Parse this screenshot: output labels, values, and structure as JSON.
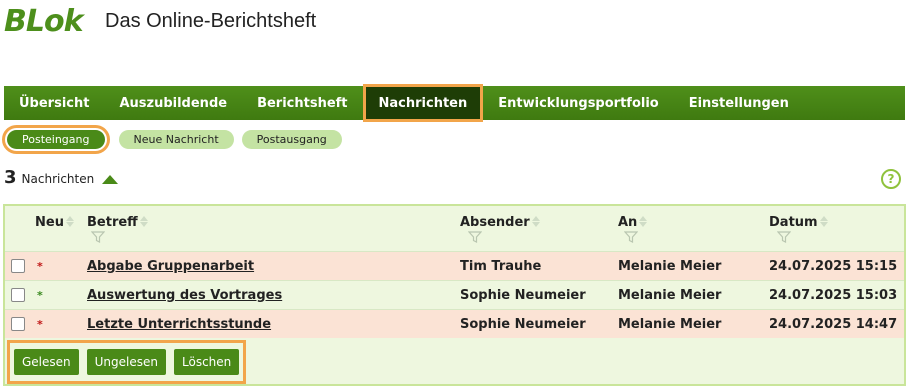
{
  "header": {
    "logo_text": "BLok",
    "title": "Das Online-Berichtsheft"
  },
  "nav": {
    "items": [
      {
        "label": "Übersicht"
      },
      {
        "label": "Auszubildende"
      },
      {
        "label": "Berichtsheft"
      },
      {
        "label": "Nachrichten",
        "active": true
      },
      {
        "label": "Entwicklungsportfolio"
      },
      {
        "label": "Einstellungen"
      }
    ]
  },
  "subnav": {
    "items": [
      {
        "label": "Posteingang",
        "active": true
      },
      {
        "label": "Neue Nachricht"
      },
      {
        "label": "Postausgang"
      }
    ]
  },
  "summary": {
    "count": "3",
    "label": "Nachrichten"
  },
  "help": {
    "label": "?"
  },
  "table": {
    "headers": {
      "new": "Neu",
      "subject": "Betreff",
      "sender": "Absender",
      "recipient": "An",
      "date": "Datum"
    },
    "rows": [
      {
        "marker": "*",
        "subject": "Abgabe Gruppenarbeit",
        "sender": "Tim Trauhe",
        "recipient": "Melanie Meier",
        "date": "24.07.2025 15:15",
        "unread": true
      },
      {
        "marker": "*",
        "subject": "Auswertung des Vortrages",
        "sender": "Sophie Neumeier",
        "recipient": "Melanie Meier",
        "date": "24.07.2025 15:03",
        "unread": false
      },
      {
        "marker": "*",
        "subject": "Letzte Unterrichtsstunde",
        "sender": "Sophie Neumeier",
        "recipient": "Melanie Meier",
        "date": "24.07.2025 14:47",
        "unread": true
      }
    ]
  },
  "actions": {
    "read": "Gelesen",
    "unread": "Ungelesen",
    "delete": "Löschen"
  },
  "colors": {
    "brand_green": "#4a8a18",
    "highlight_orange": "#f2a54a",
    "unread_row": "#fbe3d5",
    "read_row": "#eef7df"
  }
}
